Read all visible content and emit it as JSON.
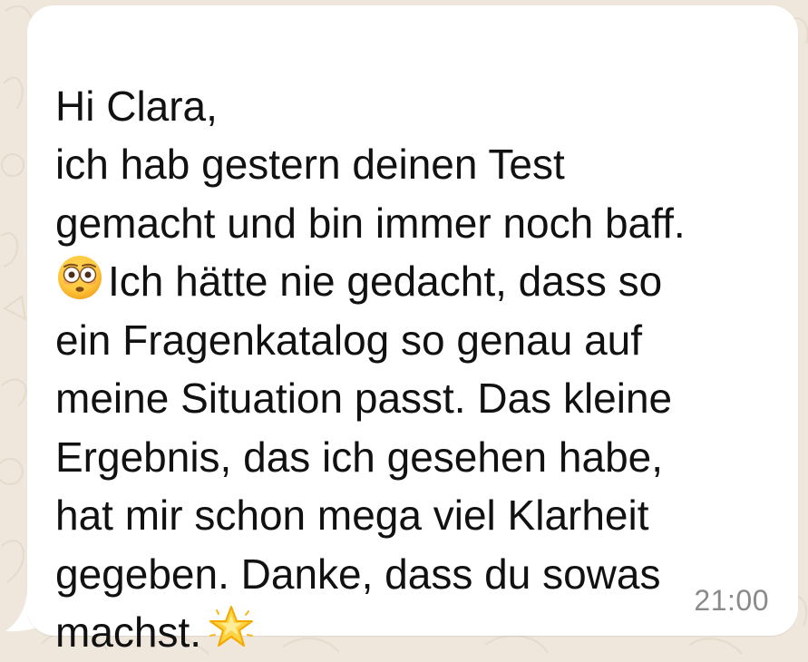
{
  "chat": {
    "message": {
      "greeting": "Hi Clara,",
      "line_2": "ich hab gestern deinen Test",
      "line_3": "gemacht und bin immer noch baff.",
      "line_4_after_emoji": "Ich hätte nie gedacht, dass so",
      "line_5": "ein Fragenkatalog so genau auf",
      "line_6": "meine Situation passt. Das kleine",
      "line_7": "Ergebnis, das ich gesehen habe,",
      "line_8": "hat mir schon mega viel Klarheit",
      "line_9": "gegeben. Danke, dass du sowas",
      "line_10_before_emoji": "machst.",
      "timestamp": "21:00",
      "emoji_1": "flushed-face-icon",
      "emoji_2": "glowing-star-icon"
    }
  },
  "colors": {
    "chat_background": "#efe7dc",
    "bubble": "#ffffff",
    "message_text": "#111111",
    "timestamp": "#8a8a8a"
  }
}
